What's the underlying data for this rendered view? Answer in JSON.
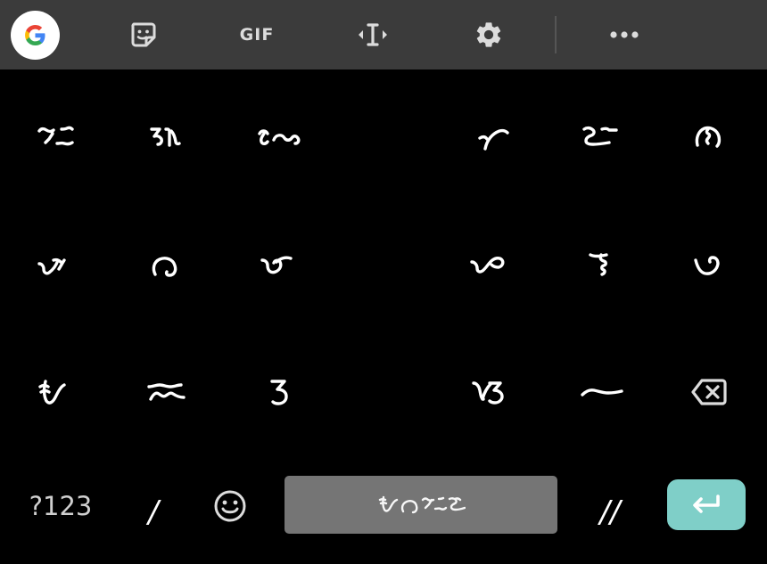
{
  "toolbar": {
    "google_button": {
      "icon": "google-g-icon"
    },
    "sticker_button": {
      "icon": "sticker-icon"
    },
    "gif_button": {
      "label": "GIF"
    },
    "text_edit_button": {
      "icon": "text-cursor-icon"
    },
    "settings_button": {
      "icon": "gear-icon"
    },
    "more_button": {
      "icon": "more-horizontal-icon"
    }
  },
  "keys": {
    "row1": [
      {
        "name": "baybayin-i-key",
        "char": "ᜁ"
      },
      {
        "name": "baybayin-u-key",
        "char": "ᜂ"
      },
      {
        "name": "baybayin-ka-key",
        "char": "ᜃ"
      },
      {
        "name": "baybayin-nga-key",
        "char": "ᜅ"
      },
      {
        "name": "baybayin-ta-key",
        "char": "ᜆ"
      },
      {
        "name": "baybayin-pa-key",
        "char": "ᜉ"
      }
    ],
    "row2": [
      {
        "name": "baybayin-a-key",
        "char": "ᜀ"
      },
      {
        "name": "baybayin-da-key",
        "char": "ᜇ"
      },
      {
        "name": "baybayin-ga-key",
        "char": "ᜄ"
      },
      {
        "name": "baybayin-ba-key",
        "char": "ᜊ"
      },
      {
        "name": "baybayin-ma-key",
        "char": "ᜋ"
      },
      {
        "name": "baybayin-na-key",
        "char": "ᜈ"
      }
    ],
    "row3": [
      {
        "name": "baybayin-ya-key",
        "char": "ᜌ"
      },
      {
        "name": "baybayin-sa-key",
        "char": "ᜐ"
      },
      {
        "name": "baybayin-la-key",
        "char": "ᜎ"
      },
      {
        "name": "baybayin-wa-key",
        "char": "ᜏ"
      },
      {
        "name": "baybayin-ha-key",
        "char": "ᜑ"
      },
      {
        "name": "backspace-key",
        "icon": "backspace-icon"
      }
    ]
  },
  "bottom_row": {
    "symbols_label": "?123",
    "single_punct_label": "/",
    "emoji_icon": "emoji-smile-icon",
    "space_label": "ᜌᜇᜁᜈ",
    "double_punct_label": "//",
    "enter_icon": "enter-return-icon"
  },
  "colors": {
    "keyboard_bg": "#000000",
    "toolbar_bg": "#3b3b3b",
    "key_text": "#ffffff",
    "space_bar": "#757575",
    "enter_accent": "#7fcfc8",
    "toolbar_icon": "#dcdcdc"
  }
}
